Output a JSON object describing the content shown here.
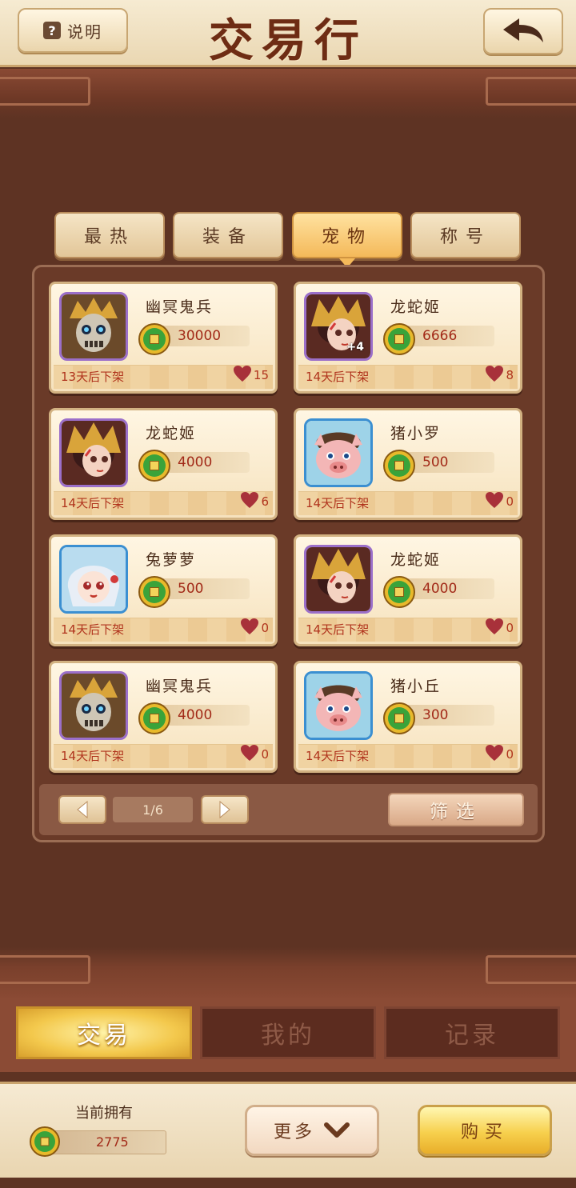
{
  "header": {
    "help_label": "说明",
    "help_icon": "question-icon",
    "title": "交易行",
    "back_icon": "back-arrow-icon"
  },
  "categories": [
    {
      "label": "最热",
      "active": false
    },
    {
      "label": "装备",
      "active": false
    },
    {
      "label": "宠物",
      "active": true
    },
    {
      "label": "称号",
      "active": false
    }
  ],
  "listings": [
    {
      "name": "幽冥鬼兵",
      "price": "30000",
      "expire": "13天后下架",
      "likes": "15",
      "badge": "",
      "frame": "purple",
      "art": "skeleton"
    },
    {
      "name": "龙蛇姬",
      "price": "6666",
      "expire": "14天后下架",
      "likes": "8",
      "badge": "+4",
      "frame": "purple",
      "art": "dragon-lady"
    },
    {
      "name": "龙蛇姬",
      "price": "4000",
      "expire": "14天后下架",
      "likes": "6",
      "badge": "",
      "frame": "purple",
      "art": "dragon-lady"
    },
    {
      "name": "猪小罗",
      "price": "500",
      "expire": "14天后下架",
      "likes": "0",
      "badge": "",
      "frame": "blue",
      "art": "pig"
    },
    {
      "name": "兔萝萝",
      "price": "500",
      "expire": "14天后下架",
      "likes": "0",
      "badge": "",
      "frame": "blue",
      "art": "rabbit-girl"
    },
    {
      "name": "龙蛇姬",
      "price": "4000",
      "expire": "14天后下架",
      "likes": "0",
      "badge": "",
      "frame": "purple",
      "art": "dragon-lady"
    },
    {
      "name": "幽冥鬼兵",
      "price": "4000",
      "expire": "14天后下架",
      "likes": "0",
      "badge": "",
      "frame": "purple",
      "art": "skeleton"
    },
    {
      "name": "猪小丘",
      "price": "300",
      "expire": "14天后下架",
      "likes": "0",
      "badge": "",
      "frame": "blue",
      "art": "pig"
    }
  ],
  "pager": {
    "page_indicator": "1/6",
    "prev_icon": "left-arrow-icon",
    "next_icon": "right-arrow-icon",
    "filter_label": "筛选"
  },
  "main_tabs": [
    {
      "label": "交易",
      "active": true
    },
    {
      "label": "我的",
      "active": false
    },
    {
      "label": "记录",
      "active": false
    }
  ],
  "bottom": {
    "own_label": "当前拥有",
    "own_amount": "2775",
    "more_label": "更多",
    "more_icon": "chevron-down-icon",
    "buy_label": "购买"
  },
  "colors": {
    "background": "#5e3323",
    "title": "#6e2c14",
    "price": "#a22a18",
    "active_tab": "#f4b95a",
    "heart": "#a8313a"
  }
}
